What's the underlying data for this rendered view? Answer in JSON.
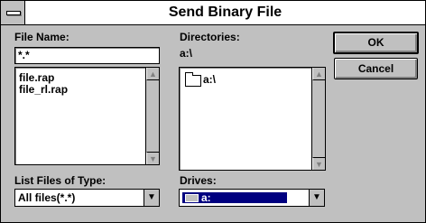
{
  "window": {
    "title": "Send Binary File"
  },
  "file_name": {
    "label": "File Name:",
    "value": "*.*"
  },
  "files": [
    "file.rap",
    "file_rl.rap"
  ],
  "directories": {
    "label": "Directories:",
    "path": "a:\\",
    "items": [
      "a:\\"
    ]
  },
  "buttons": {
    "ok": "OK",
    "cancel": "Cancel"
  },
  "list_type": {
    "label": "List Files of Type:",
    "value": "All files(*.*)"
  },
  "drives": {
    "label": "Drives:",
    "value": "a:"
  }
}
